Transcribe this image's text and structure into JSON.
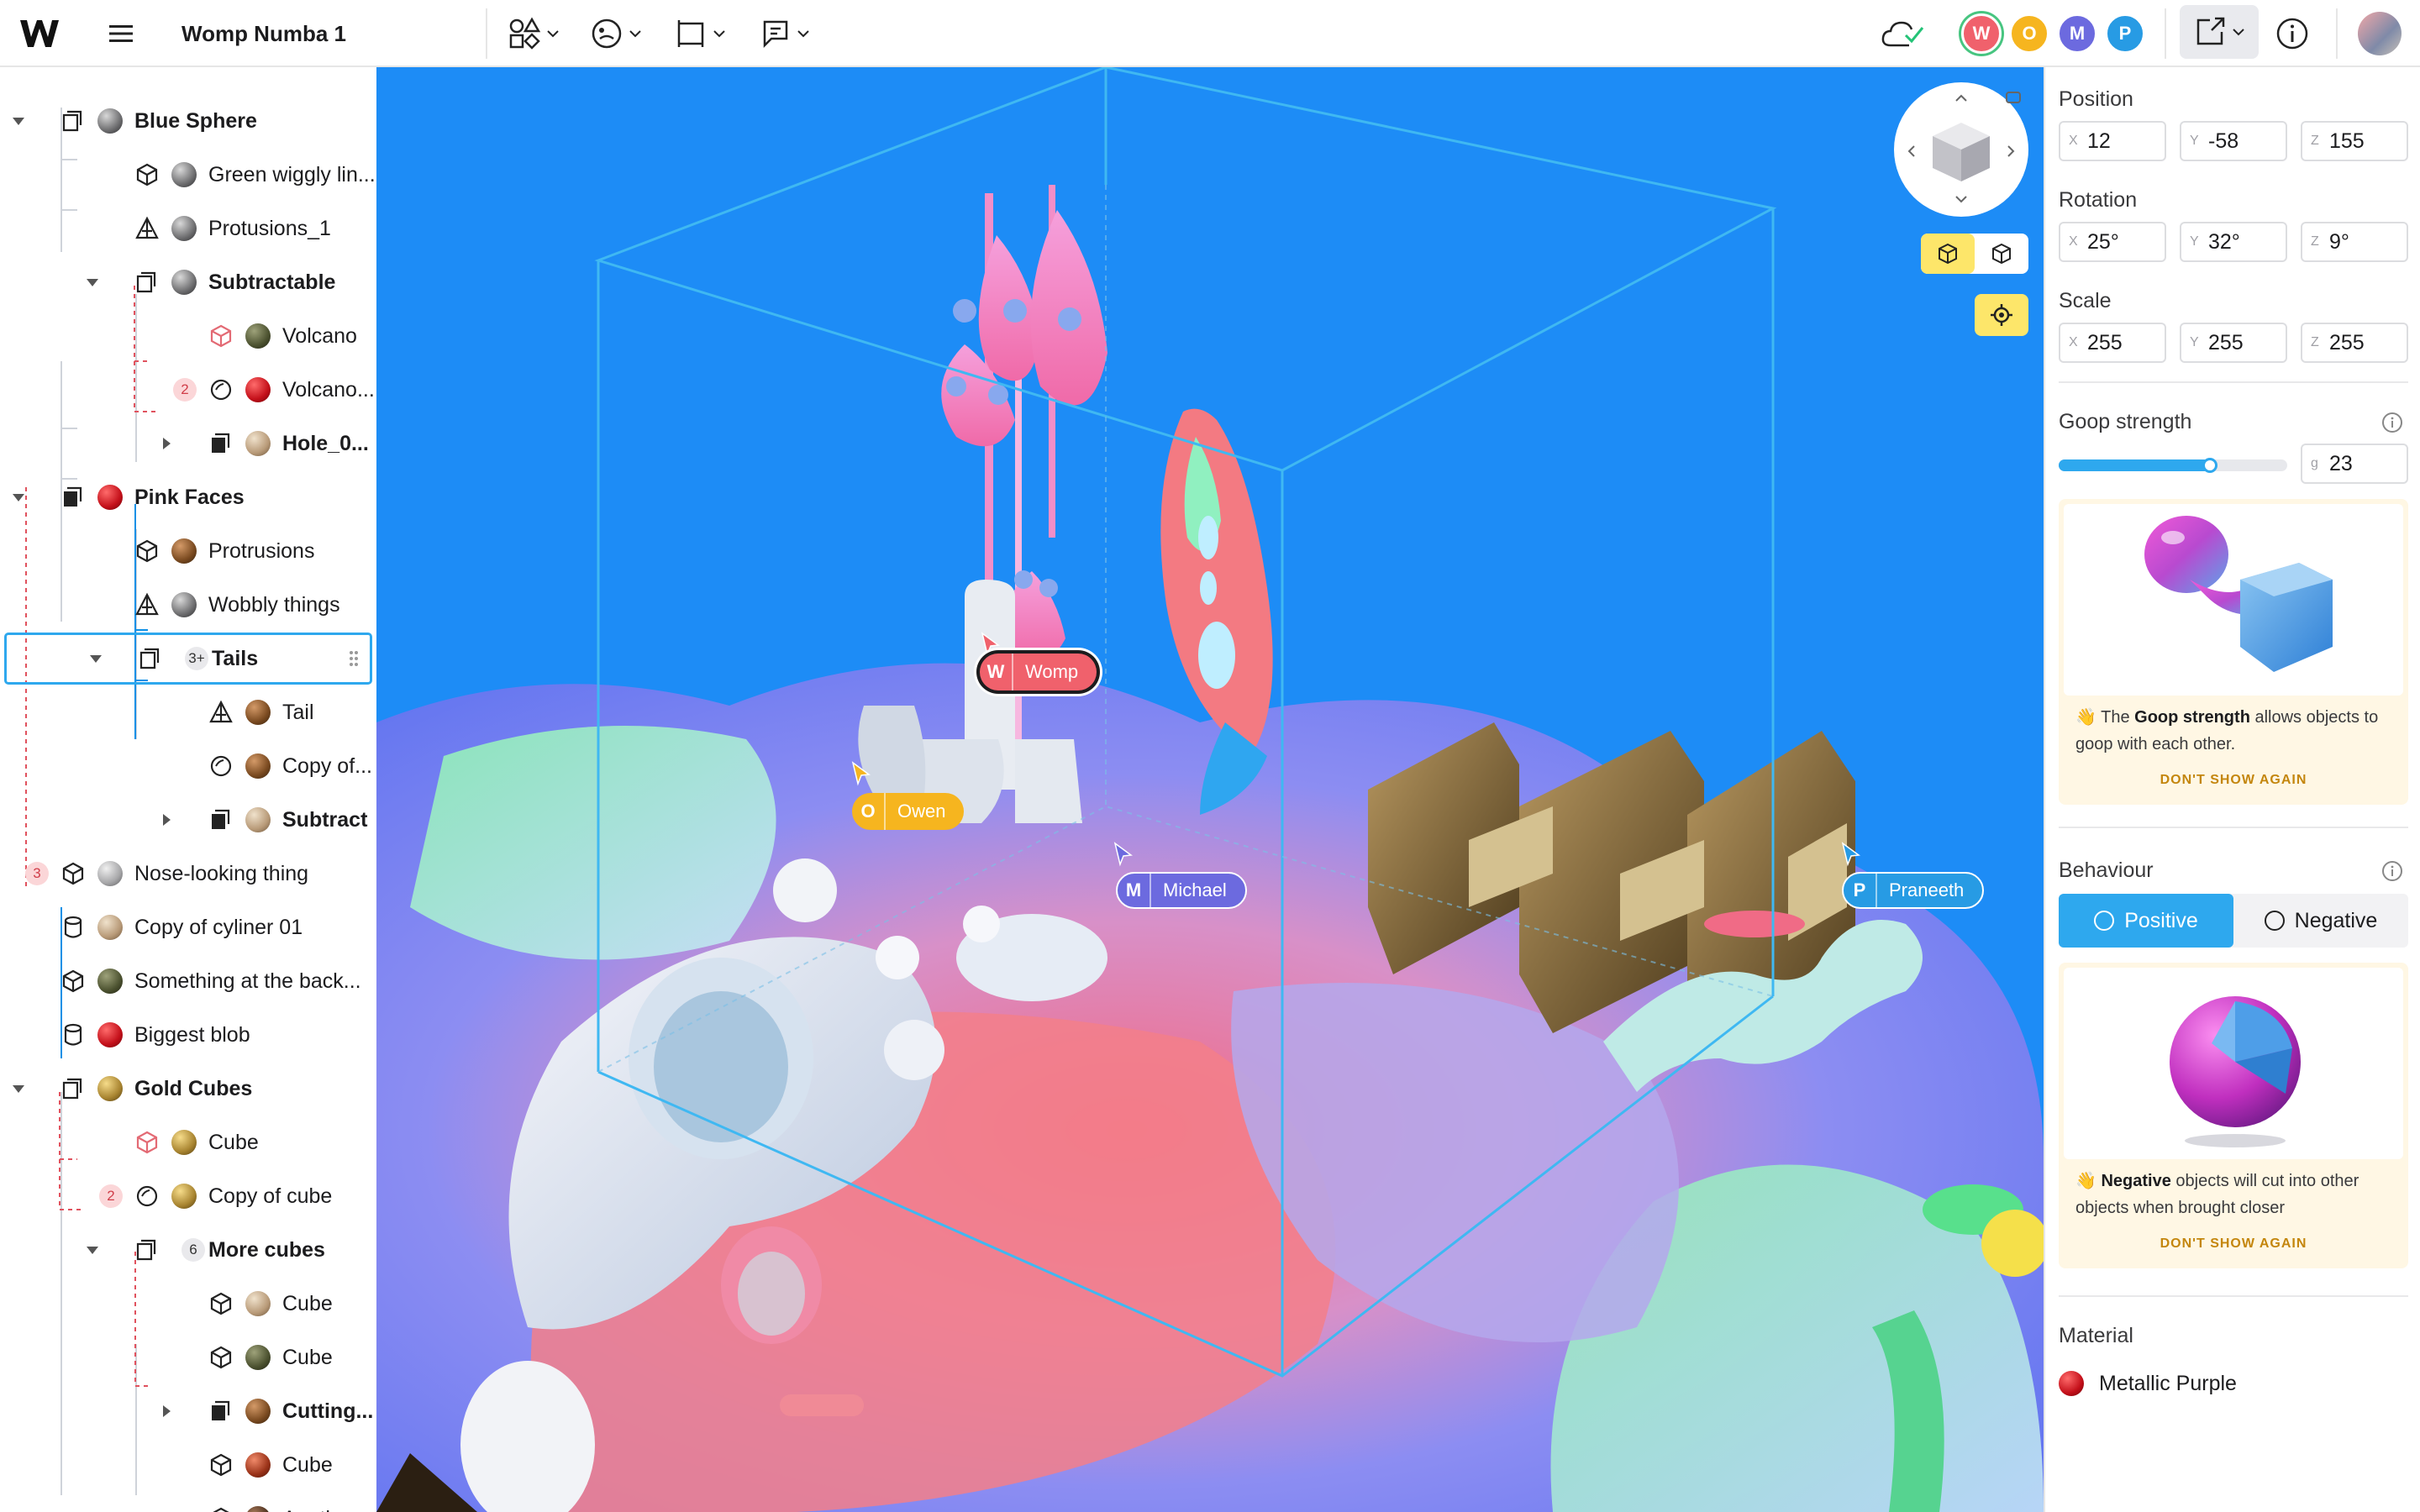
{
  "app": {
    "title": "Womp Numba 1"
  },
  "collaborators": [
    {
      "initial": "W",
      "name": "Womp",
      "color": "#f0616c"
    },
    {
      "initial": "O",
      "name": "Owen",
      "color": "#f6b51f"
    },
    {
      "initial": "M",
      "name": "Michael",
      "color": "#6c6adf"
    },
    {
      "initial": "P",
      "name": "Praneeth",
      "color": "#279be4"
    }
  ],
  "tree": [
    {
      "label": "Blue Sphere",
      "bold": true,
      "expanded": true,
      "icon": "group-icon",
      "ball": "sphere-gray"
    },
    {
      "label": "Green wiggly lin...",
      "icon": "cube-icon",
      "ball": "sphere-gray"
    },
    {
      "label": "Protusions_1",
      "icon": "pyramid-icon",
      "ball": "sphere-gray"
    },
    {
      "label": "Subtractable",
      "bold": true,
      "expanded": true,
      "icon": "group-icon",
      "ball": "sphere-gray"
    },
    {
      "label": "Volcano",
      "icon": "cube-red-icon",
      "ball": "sphere-olive"
    },
    {
      "label": "Volcano...",
      "icon": "circle-icon",
      "ball": "sphere-red",
      "badge": "2"
    },
    {
      "label": "Hole_0...",
      "bold": true,
      "collapsed": true,
      "icon": "group-solid-icon",
      "ball": "sphere-sand"
    },
    {
      "label": "Pink Faces",
      "bold": true,
      "expanded": true,
      "icon": "group-solid-icon",
      "ball": "sphere-red"
    },
    {
      "label": "Protrusions",
      "icon": "cube-icon",
      "ball": "sphere-brown"
    },
    {
      "label": "Wobbly things",
      "icon": "pyramid-icon",
      "ball": "sphere-gray"
    },
    {
      "label": "Tails",
      "bold": true,
      "expanded": true,
      "icon": "group-icon",
      "badge": "3+",
      "selected": true
    },
    {
      "label": "Tail",
      "icon": "pyramid-icon",
      "ball": "sphere-brown"
    },
    {
      "label": "Copy of...",
      "icon": "circle-icon",
      "ball": "sphere-brown"
    },
    {
      "label": "Subtract",
      "bold": true,
      "collapsed": true,
      "icon": "group-solid-icon",
      "ball": "sphere-sand"
    },
    {
      "label": "Nose-looking thing",
      "icon": "cube-icon",
      "ball": "sphere-lightgray",
      "badge": "3"
    },
    {
      "label": "Copy of cyliner 01",
      "icon": "cylinder-icon",
      "ball": "sphere-sand"
    },
    {
      "label": "Something at the back...",
      "icon": "cube-icon",
      "ball": "sphere-olive"
    },
    {
      "label": "Biggest blob",
      "icon": "cylinder-icon",
      "ball": "sphere-red"
    },
    {
      "label": "Gold Cubes",
      "bold": true,
      "expanded": true,
      "icon": "group-icon",
      "ball": "sphere-gold"
    },
    {
      "label": "Cube",
      "icon": "cube-red-icon",
      "ball": "sphere-gold"
    },
    {
      "label": "Copy of cube",
      "icon": "circle-icon",
      "ball": "sphere-gold",
      "badge": "2"
    },
    {
      "label": "More cubes",
      "bold": true,
      "expanded": true,
      "icon": "group-icon",
      "badge": "6"
    },
    {
      "label": "Cube",
      "icon": "cube-icon",
      "ball": "sphere-sand"
    },
    {
      "label": "Cube",
      "icon": "cube-icon",
      "ball": "sphere-olive"
    },
    {
      "label": "Cutting...",
      "bold": true,
      "collapsed": true,
      "icon": "group-solid-icon",
      "ball": "sphere-brown"
    },
    {
      "label": "Cube",
      "icon": "cube-icon",
      "ball": "sphere-rust"
    },
    {
      "label": "Another",
      "icon": "cube-icon",
      "ball": "sphere-darkbrown"
    }
  ],
  "properties": {
    "position": {
      "label": "Position",
      "x": "12",
      "y": "-58",
      "z": "155"
    },
    "rotation": {
      "label": "Rotation",
      "x": "25°",
      "y": "32°",
      "z": "9°"
    },
    "scale": {
      "label": "Scale",
      "x": "255",
      "y": "255",
      "z": "255"
    },
    "axis_labels": {
      "x": "X",
      "y": "Y",
      "z": "Z"
    },
    "goop": {
      "label": "Goop strength",
      "unit": "g",
      "value": "23",
      "fill": 0.66
    },
    "goop_tip": {
      "prefix": "The",
      "bold": "Goop strength",
      "rest": "allows objects to goop with each other.",
      "dismiss": "DON'T SHOW AGAIN"
    },
    "behaviour": {
      "label": "Behaviour",
      "positive": "Positive",
      "negative": "Negative",
      "selected": "Positive"
    },
    "behaviour_tip": {
      "bold": "Negative",
      "rest": "objects will cut into other objects when brought closer",
      "dismiss": "DON'T SHOW AGAIN"
    },
    "material": {
      "label": "Material",
      "value": "Metallic Purple"
    }
  },
  "colors": {
    "accent": "#2ea8ee",
    "highlight": "#fde66a",
    "viewport_bg": "#1d8cf6",
    "badge_red": "#d03e49"
  }
}
